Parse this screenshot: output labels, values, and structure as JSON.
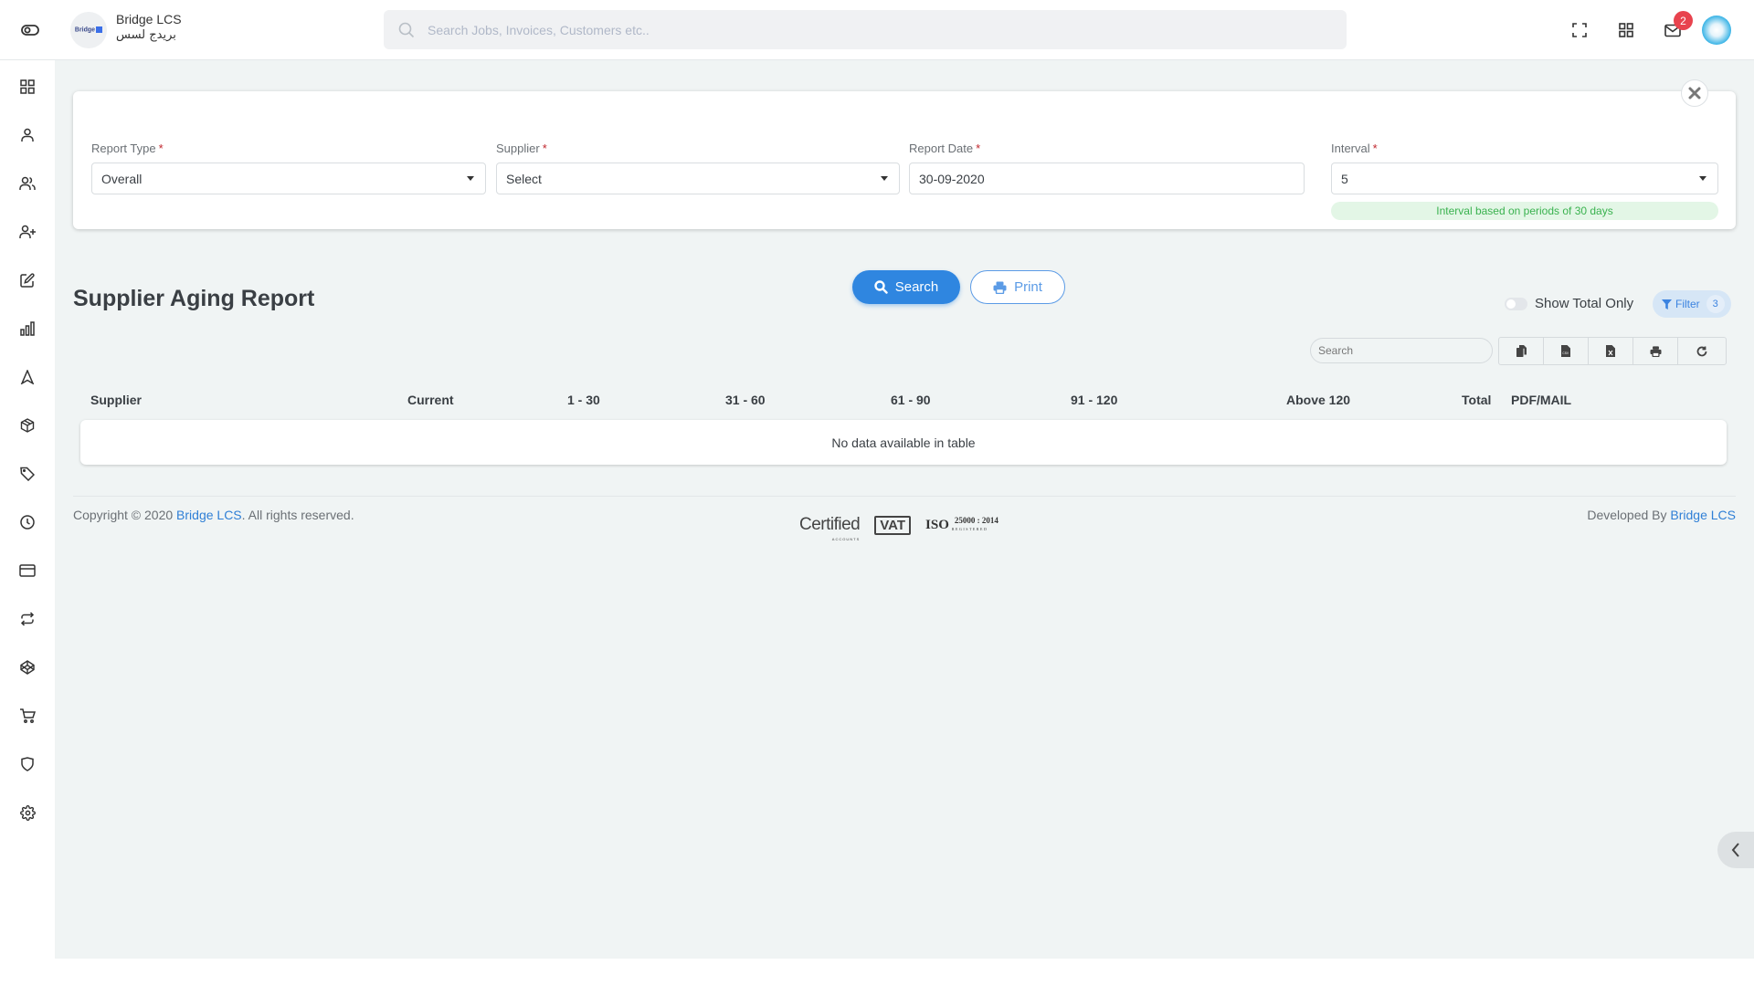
{
  "header": {
    "brand_en": "Bridge LCS",
    "brand_ar": "بريدج لسس",
    "logo_text": "Bridge",
    "search_placeholder": "Search Jobs, Invoices, Customers etc..",
    "notification_count": "2",
    "icons": [
      "menu-toggle-icon",
      "fullscreen-icon",
      "apps-grid-icon",
      "mail-icon",
      "avatar"
    ]
  },
  "sidebar": {
    "items": [
      {
        "icon": "dashboard-icon"
      },
      {
        "icon": "user-icon"
      },
      {
        "icon": "users-icon"
      },
      {
        "icon": "user-add-icon"
      },
      {
        "icon": "edit-icon"
      },
      {
        "icon": "bar-chart-icon"
      },
      {
        "icon": "navigation-icon"
      },
      {
        "icon": "package-icon"
      },
      {
        "icon": "tag-icon"
      },
      {
        "icon": "clock-icon"
      },
      {
        "icon": "credit-card-icon"
      },
      {
        "icon": "repeat-icon"
      },
      {
        "icon": "codepen-icon"
      },
      {
        "icon": "shopping-cart-icon"
      },
      {
        "icon": "shield-icon"
      },
      {
        "icon": "settings-icon"
      }
    ]
  },
  "filters": {
    "report_type": {
      "label": "Report Type",
      "value": "Overall"
    },
    "supplier": {
      "label": "Supplier",
      "value": "Select"
    },
    "report_date": {
      "label": "Report Date",
      "value": "30-09-2020"
    },
    "interval": {
      "label": "Interval",
      "value": "5",
      "hint": "Interval based on periods of 30 days"
    },
    "required_mark": "*",
    "search_button": "Search",
    "print_button": "Print"
  },
  "report": {
    "title": "Supplier Aging Report",
    "show_total_label": "Show Total Only",
    "show_total_checked": false,
    "filter_label": "Filter",
    "filter_count": "3",
    "table_search_placeholder": "Search",
    "tools": [
      "copy",
      "csv",
      "excel",
      "print",
      "refresh"
    ],
    "columns": [
      "Supplier",
      "Current",
      "1 - 30",
      "31 - 60",
      "61 - 90",
      "91 - 120",
      "Above 120",
      "Total",
      "PDF/MAIL"
    ],
    "empty_message": "No data available in table"
  },
  "footer": {
    "copyright_prefix": "Copyright © 2020 ",
    "copyright_link": "Bridge LCS",
    "copyright_suffix": ". All rights reserved.",
    "developed_prefix": "Developed By ",
    "developed_link": "Bridge LCS",
    "cert_certified": "Certified",
    "cert_certified_sub": "ACCOUNTS",
    "cert_vat": "VAT",
    "cert_iso": "ISO",
    "cert_iso_num": "25000 : 2014",
    "cert_iso_sub": "REGISTERED"
  }
}
